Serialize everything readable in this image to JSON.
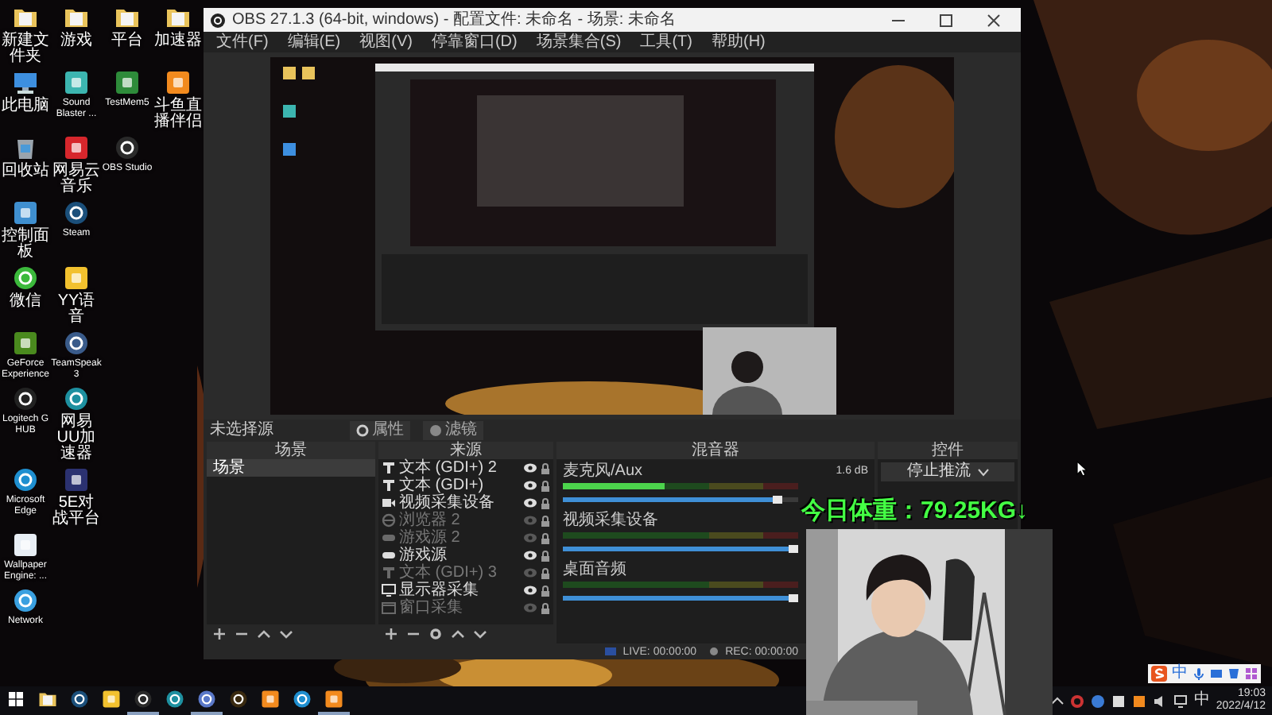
{
  "desktop": {
    "rows": [
      [
        {
          "label": "新建文件夹",
          "kind": "folder"
        },
        {
          "label": "游戏",
          "kind": "folder"
        },
        {
          "label": "平台",
          "kind": "folder"
        },
        {
          "label": "加速器",
          "kind": "folder"
        }
      ],
      [
        {
          "label": "此电脑",
          "kind": "pc"
        },
        {
          "label": "Sound Blaster ...",
          "kind": "app",
          "color": "#3cb5b0"
        },
        {
          "label": "TestMem5",
          "kind": "app",
          "color": "#2e8b3a"
        },
        {
          "label": "斗鱼直播伴侣",
          "kind": "app",
          "color": "#f28a1e"
        }
      ],
      [
        {
          "label": "回收站",
          "kind": "bin"
        },
        {
          "label": "网易云音乐",
          "kind": "app",
          "color": "#d6262c"
        },
        {
          "label": "OBS Studio",
          "kind": "round",
          "color": "#2a2a2a"
        }
      ],
      [
        {
          "label": "控制面板",
          "kind": "app",
          "color": "#3f8fd0"
        },
        {
          "label": "Steam",
          "kind": "round",
          "color": "#1b4f7a"
        }
      ],
      [
        {
          "label": "微信",
          "kind": "round",
          "color": "#3cb93c"
        },
        {
          "label": "YY语音",
          "kind": "app",
          "color": "#f2c12e"
        }
      ],
      [
        {
          "label": "GeForce Experience",
          "kind": "app",
          "color": "#4a8a1e"
        },
        {
          "label": "TeamSpeak 3",
          "kind": "round",
          "color": "#3a5b8a"
        }
      ],
      [
        {
          "label": "Logitech G HUB",
          "kind": "round",
          "color": "#222222"
        },
        {
          "label": "网易UU加速器",
          "kind": "round",
          "color": "#1e90a0"
        }
      ],
      [
        {
          "label": "Microsoft Edge",
          "kind": "round",
          "color": "#1f8fd0"
        },
        {
          "label": "5E对战平台",
          "kind": "app",
          "color": "#2b3170"
        }
      ],
      [
        {
          "label": "Wallpaper Engine: ...",
          "kind": "app",
          "color": "#e8eef5"
        }
      ],
      [
        {
          "label": "Network",
          "kind": "round",
          "color": "#3aa0e0"
        }
      ]
    ]
  },
  "obs": {
    "title": "OBS 27.1.3 (64-bit, windows) - 配置文件: 未命名 - 场景: 未命名",
    "menu": [
      "文件(F)",
      "编辑(E)",
      "视图(V)",
      "停靠窗口(D)",
      "场景集合(S)",
      "工具(T)",
      "帮助(H)"
    ],
    "source_bar": {
      "label": "未选择源",
      "buttons": [
        "属性",
        "滤镜"
      ]
    },
    "scenes": {
      "header": "场景",
      "items": [
        {
          "label": "场景",
          "selected": true
        }
      ]
    },
    "sources": {
      "header": "来源",
      "items": [
        {
          "label": "文本 (GDI+) 2",
          "kind": "text",
          "visible": true
        },
        {
          "label": "文本 (GDI+)",
          "kind": "text",
          "visible": true
        },
        {
          "label": "视频采集设备",
          "kind": "camera",
          "visible": true
        },
        {
          "label": "浏览器 2",
          "kind": "browser",
          "visible": false
        },
        {
          "label": "游戏源 2",
          "kind": "game",
          "visible": false
        },
        {
          "label": "游戏源",
          "kind": "game",
          "visible": true
        },
        {
          "label": "文本 (GDI+) 3",
          "kind": "text",
          "visible": false
        },
        {
          "label": "显示器采集",
          "kind": "monitor",
          "visible": true
        },
        {
          "label": "窗口采集",
          "kind": "window",
          "visible": false
        }
      ]
    },
    "mixer": {
      "header": "混音器",
      "channels": [
        {
          "name": "麦克风/Aux",
          "reading": "1.6 dB",
          "meter": {
            "level": 0.43
          },
          "volume": {
            "level": 0.93
          }
        },
        {
          "name": "视频采集设备",
          "meter": {
            "level": 0
          },
          "volume": {
            "level": 1
          }
        },
        {
          "name": "桌面音频",
          "meter": {
            "level": 0
          },
          "volume": {
            "level": 1
          }
        }
      ]
    },
    "controls": {
      "header": "控件",
      "buttons": [
        "停止推流"
      ]
    },
    "status": {
      "live": "LIVE: 00:00:00",
      "rec": "REC: 00:00:00"
    }
  },
  "overlay_text": "今日体重：79.25KG↓",
  "taskbar": {
    "apps": [
      {
        "kind": "windows",
        "active": false
      },
      {
        "kind": "folder",
        "active": false
      },
      {
        "kind": "round",
        "color": "#1b4f7a",
        "active": false
      },
      {
        "kind": "app",
        "color": "#f2c12e",
        "active": false
      },
      {
        "kind": "round",
        "color": "#2a2a2a",
        "active": true
      },
      {
        "kind": "round",
        "color": "#1e90a0",
        "active": false
      },
      {
        "kind": "round",
        "color": "#5a78c8",
        "active": true
      },
      {
        "kind": "round",
        "color": "#3a2a10",
        "active": false
      },
      {
        "kind": "app",
        "color": "#f28a1e",
        "active": false
      },
      {
        "kind": "round",
        "color": "#1f8fd0",
        "active": false
      },
      {
        "kind": "app",
        "color": "#f28a1e",
        "active": true
      }
    ],
    "ime_bar": "中",
    "ime": "中",
    "time": "19:03",
    "date": "2022/4/12"
  }
}
